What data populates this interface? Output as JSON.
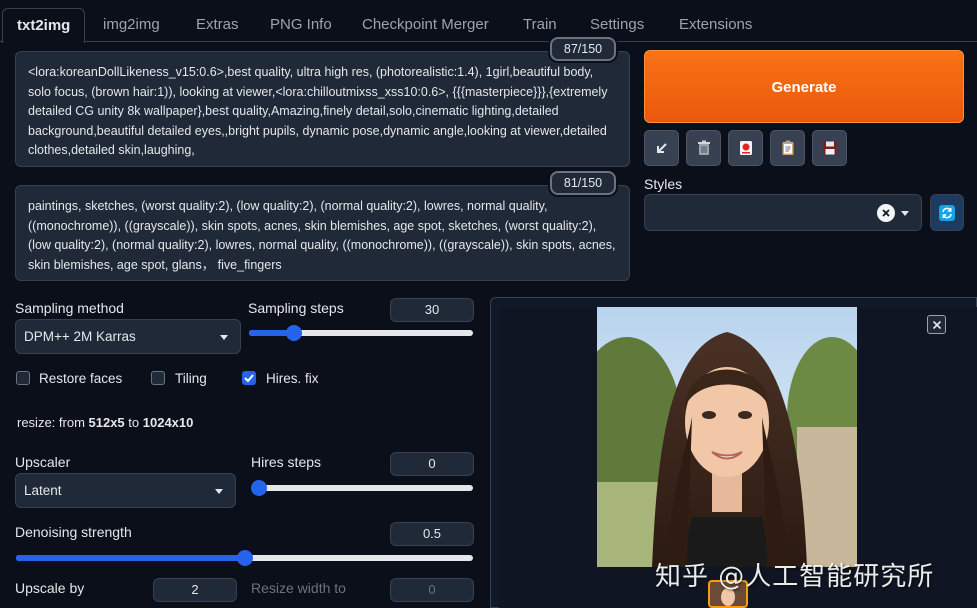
{
  "tabs": [
    "txt2img",
    "img2img",
    "Extras",
    "PNG Info",
    "Checkpoint Merger",
    "Train",
    "Settings",
    "Extensions"
  ],
  "prompt": {
    "text": "<lora:koreanDollLikeness_v15:0.6>,best quality, ultra high res, (photorealistic:1.4), 1girl,beautiful body, solo focus, (brown hair:1)), looking at viewer,<lora:chilloutmixss_xss10:0.6>, {{{masterpiece}}},{extremely detailed CG unity 8k wallpaper},best quality,Amazing,finely detail,solo,cinematic lighting,detailed background,beautiful detailed eyes,,bright pupils, dynamic pose,dynamic angle,looking at viewer,detailed clothes,detailed skin,laughing,",
    "counter": "87/150"
  },
  "negative_prompt": {
    "text": "paintings, sketches, (worst quality:2), (low quality:2), (normal quality:2), lowres, normal quality, ((monochrome)), ((grayscale)), skin spots, acnes, skin blemishes, age spot, sketches, (worst quality:2), (low quality:2), (normal quality:2), lowres, normal quality, ((monochrome)), ((grayscale)), skin spots, acnes, skin blemishes, age spot, glans， five_fingers",
    "counter": "81/150"
  },
  "generate_label": "Generate",
  "tool_buttons": [
    "arrow-icon",
    "trash-icon",
    "card-icon",
    "clipboard-icon",
    "save-icon"
  ],
  "styles": {
    "label": "Styles",
    "value": ""
  },
  "sampling": {
    "method_label": "Sampling method",
    "method_value": "DPM++ 2M Karras",
    "steps_label": "Sampling steps",
    "steps_value": "30",
    "steps_fraction": 0.2
  },
  "checkboxes": [
    {
      "label": "Restore faces",
      "checked": false
    },
    {
      "label": "Tiling",
      "checked": false
    },
    {
      "label": "Hires. fix",
      "checked": true
    }
  ],
  "resize_text": {
    "prefix": "resize: from ",
    "from": "512x5",
    "mid": " to ",
    "to": "1024x10"
  },
  "upscaler": {
    "label": "Upscaler",
    "value": "Latent"
  },
  "hires_steps": {
    "label": "Hires steps",
    "value": "0",
    "fraction": 0.0
  },
  "denoising": {
    "label": "Denoising strength",
    "value": "0.5",
    "fraction": 0.5
  },
  "upscale_by": {
    "label": "Upscale by",
    "value": "2"
  },
  "resize_width": {
    "label": "Resize width to",
    "value": "0"
  },
  "watermark": "知乎 @人工智能研究所",
  "colors": {
    "accent": "#2563eb",
    "generate": "#f97316",
    "background": "#0b0f19",
    "panel": "#1f2937"
  }
}
